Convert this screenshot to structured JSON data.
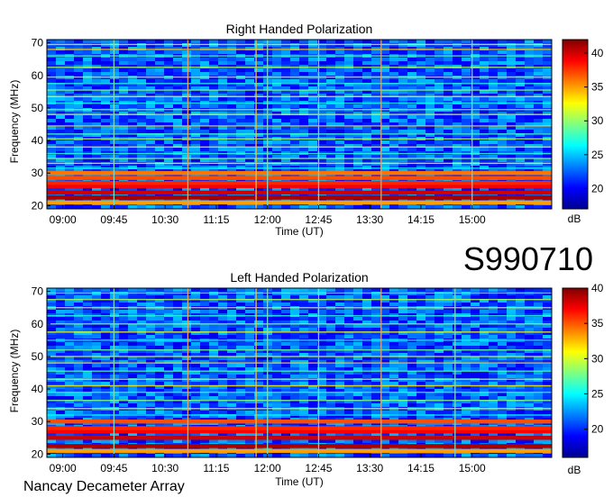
{
  "chart_data": [
    {
      "type": "heatmap",
      "title": "Right Handed Polarization",
      "xlabel": "Time (UT)",
      "ylabel": "Frequency (MHz)",
      "x_ticks": [
        "09:00",
        "09:45",
        "10:30",
        "11:15",
        "12:00",
        "12:45",
        "13:30",
        "14:15",
        "15:00"
      ],
      "y_ticks": [
        20,
        30,
        40,
        50,
        60,
        70
      ],
      "ylim": [
        19,
        71
      ],
      "colorbar": {
        "label": "dB",
        "ticks": [
          20,
          25,
          30,
          35,
          40
        ],
        "range": [
          17,
          42
        ]
      },
      "strong_bands_mhz": [
        21,
        22.5,
        24,
        26,
        27,
        28.5,
        30
      ],
      "narrow_lines_mhz": [
        31.5,
        33,
        34.5,
        36,
        38,
        40.5,
        42,
        44.5,
        48,
        49.5,
        51.5,
        53.5,
        55.5,
        57.5,
        59.5,
        62.5,
        66,
        68,
        69.5
      ],
      "vertical_lines": [
        {
          "time": "09:45",
          "color": "#7fd7c2"
        },
        {
          "time": "10:50",
          "color": "#e0a070"
        },
        {
          "time": "11:50",
          "color": "#f0c040"
        },
        {
          "time": "12:00",
          "color": "#7fd7c2"
        },
        {
          "time": "12:45",
          "color": "#7fd7c2"
        },
        {
          "time": "13:40",
          "color": "#e0a070"
        },
        {
          "time": "15:00",
          "color": "#7fd7c2"
        }
      ]
    },
    {
      "type": "heatmap",
      "title": "Left Handed Polarization",
      "xlabel": "Time (UT)",
      "ylabel": "Frequency (MHz)",
      "x_ticks": [
        "09:00",
        "09:45",
        "10:30",
        "11:15",
        "12:00",
        "12:45",
        "13:30",
        "14:15",
        "15:00"
      ],
      "y_ticks": [
        20,
        30,
        40,
        50,
        60,
        70
      ],
      "ylim": [
        19,
        71
      ],
      "colorbar": {
        "label": "dB",
        "ticks": [
          20,
          25,
          30,
          35,
          40
        ],
        "range": [
          16,
          40
        ]
      },
      "strong_bands_mhz": [
        21,
        22.5,
        25,
        27,
        28,
        30
      ],
      "narrow_lines_mhz": [
        32,
        34,
        36.5,
        39,
        41,
        43,
        45.5,
        48,
        50,
        52,
        55,
        57.5,
        60,
        62.5,
        65,
        67.5,
        69.5
      ],
      "vertical_lines": [
        {
          "time": "09:45",
          "color": "#7fd7c2"
        },
        {
          "time": "10:50",
          "color": "#e0a070"
        },
        {
          "time": "11:50",
          "color": "#f0c040"
        },
        {
          "time": "12:00",
          "color": "#7fd7c2"
        },
        {
          "time": "12:45",
          "color": "#7fd7c2"
        },
        {
          "time": "13:40",
          "color": "#e0a070"
        },
        {
          "time": "14:45",
          "color": "#7fd7c2"
        }
      ]
    }
  ],
  "observation_id": "S990710",
  "instrument": "Nancay Decameter Array"
}
